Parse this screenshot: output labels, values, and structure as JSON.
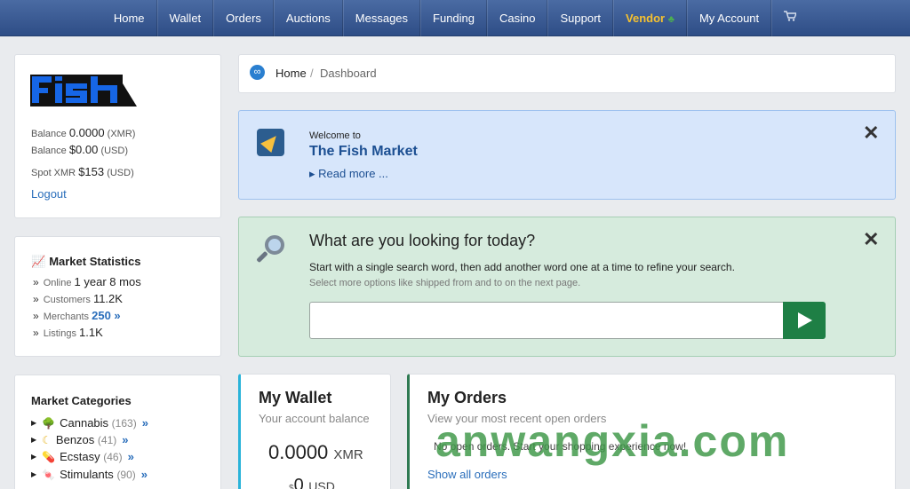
{
  "nav": {
    "items": [
      "Home",
      "Wallet",
      "Orders",
      "Auctions",
      "Messages",
      "Funding",
      "Casino",
      "Support"
    ],
    "vendor": "Vendor",
    "account": "My Account",
    "cart_icon": "cart-icon",
    "vendor_color": "#f5c130"
  },
  "account": {
    "logo_text": "fish",
    "balance_label": "Balance",
    "xmr_value": "0.0000",
    "xmr_unit": "(XMR)",
    "usd_value": "$0.00",
    "usd_unit": "(USD)",
    "spot_label": "Spot XMR",
    "spot_value": "$153",
    "spot_unit": "(USD)",
    "logout": "Logout"
  },
  "stats": {
    "title": "Market Statistics",
    "online_label": "Online",
    "online_value": "1 year 8 mos",
    "customers_label": "Customers",
    "customers_value": "11.2K",
    "merchants_label": "Merchants",
    "merchants_value": "250",
    "listings_label": "Listings",
    "listings_value": "1.1K"
  },
  "categories": {
    "title": "Market Categories",
    "items": [
      {
        "name": "Cannabis",
        "count": "(163)",
        "icon": "tree-icon"
      },
      {
        "name": "Benzos",
        "count": "(41)",
        "icon": "moon-icon"
      },
      {
        "name": "Ecstasy",
        "count": "(46)",
        "icon": "pill-icon"
      },
      {
        "name": "Stimulants",
        "count": "(90)",
        "icon": "candy-icon"
      }
    ]
  },
  "breadcrumb": {
    "home": "Home",
    "sep": "/",
    "current": "Dashboard"
  },
  "welcome": {
    "small": "Welcome to",
    "title": "The Fish Market",
    "read_more": "▸ Read more ...",
    "accent": "#d7e6fb"
  },
  "search": {
    "title": "What are you looking for today?",
    "line1": "Start with a single search word, then add another word one at a time to refine your search.",
    "line2": "Select more options like shipped from and to on the next page.",
    "value": "",
    "accent": "#d6ebdd",
    "button_color": "#1e7f45"
  },
  "wallet": {
    "title": "My Wallet",
    "subtitle": "Your account balance",
    "xmr_value": "0.0000",
    "xmr_unit": "XMR",
    "usd_symbol": "$",
    "usd_value": "0",
    "usd_unit": "USD"
  },
  "orders": {
    "title": "My Orders",
    "subtitle": "View your most recent open orders",
    "empty": "No open orders. Start your shopping experience now!",
    "link": "Show all orders"
  },
  "watermark": "anwangxia.com"
}
